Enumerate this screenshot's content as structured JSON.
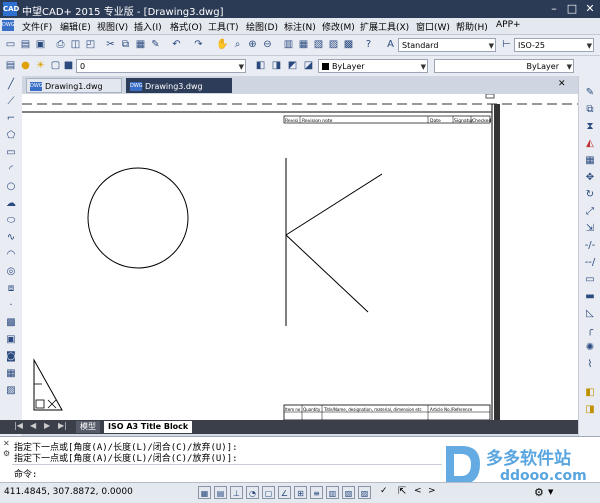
{
  "window": {
    "title": "中望CAD+ 2015 专业版 - [Drawing3.dwg]",
    "logo": "CAD"
  },
  "menu": [
    "文件(F)",
    "编辑(E)",
    "视图(V)",
    "插入(I)",
    "格式(O)",
    "工具(T)",
    "绘图(D)",
    "标注(N)",
    "修改(M)",
    "扩展工具(X)",
    "窗口(W)",
    "帮助(H)",
    "APP+"
  ],
  "toolbar1": {
    "text_style": "Standard",
    "dim_style": "ISO-25"
  },
  "toolbar2": {
    "layer": "0",
    "color": "ByLayer",
    "linetype": "ByLayer"
  },
  "tabs": [
    {
      "label": "Drawing1.dwg",
      "icon": "DWG",
      "active": false
    },
    {
      "label": "Drawing3.dwg",
      "icon": "DWG",
      "active": true
    }
  ],
  "layout_tabs": {
    "model": "模型",
    "layout": "ISO A3 Title Block"
  },
  "title_block_top": [
    "Revisi",
    "Revision note",
    "Date",
    "Signatur",
    "Checked"
  ],
  "title_block_bottom": [
    "Item no",
    "Quantity",
    "Title/Name, designation, material, dimension etc",
    "Article No./Reference"
  ],
  "command": {
    "line1": "指定下一点或[角度(A)/长度(L)/闭合(C)/放弃(U)]:",
    "line2": "指定下一点或[角度(A)/长度(L)/闭合(C)/放弃(U)]:",
    "prompt": "命令:"
  },
  "status": {
    "coords": "411.4845, 307.8872, 0.0000"
  },
  "watermark": {
    "brand": "多多软件站",
    "url": "ddooo.com"
  }
}
